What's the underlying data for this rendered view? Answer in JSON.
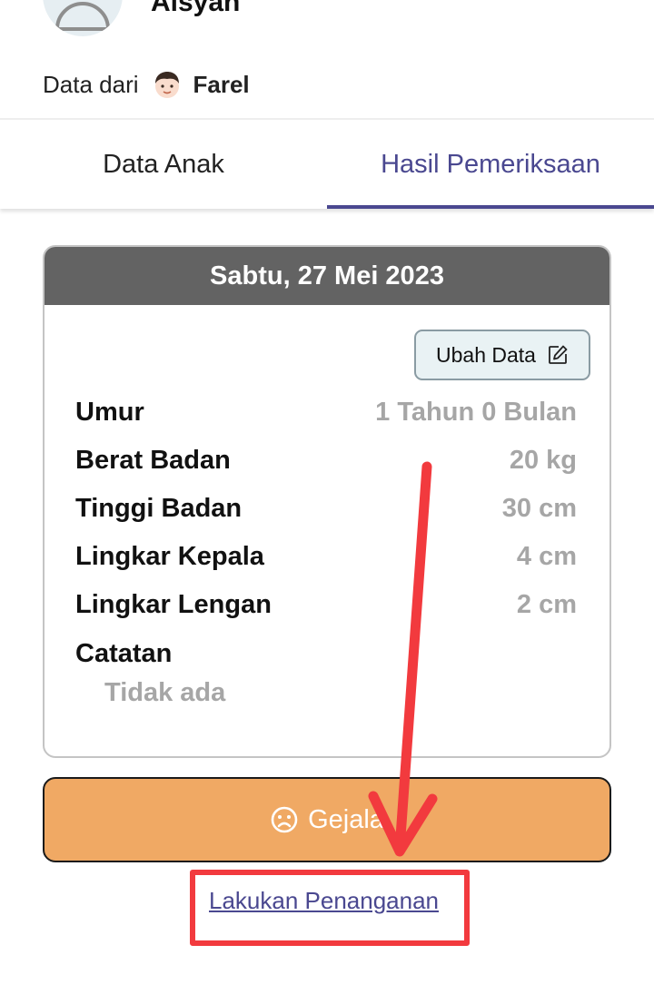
{
  "profile": {
    "child_name": "Aisyah",
    "data_from_label": "Data dari",
    "parent_name": "Farel"
  },
  "tabs": [
    {
      "label": "Data Anak",
      "active": false
    },
    {
      "label": "Hasil Pemeriksaan",
      "active": true
    }
  ],
  "exam": {
    "date": "Sabtu, 27 Mei 2023",
    "edit_label": "Ubah Data",
    "rows": [
      {
        "label": "Umur",
        "value": "1 Tahun 0 Bulan"
      },
      {
        "label": "Berat Badan",
        "value": "20 kg"
      },
      {
        "label": "Tinggi Badan",
        "value": "30 cm"
      },
      {
        "label": "Lingkar Kepala",
        "value": "4 cm"
      },
      {
        "label": "Lingkar Lengan",
        "value": "2 cm"
      }
    ],
    "notes_label": "Catatan",
    "notes_value": "Tidak ada"
  },
  "symptoms_button": {
    "label": "Gejala"
  },
  "action_link": {
    "label": "Lakukan Penanganan"
  },
  "colors": {
    "accent": "#4a4890",
    "card_header": "#636363",
    "symptoms_button": "#f0a964",
    "annotation": "#f23a3e"
  },
  "icons": {
    "avatar": "person-silhouette-icon",
    "parent": "boy-face-emoji-icon",
    "edit": "edit-pencil-icon",
    "symptoms": "sad-face-icon"
  }
}
